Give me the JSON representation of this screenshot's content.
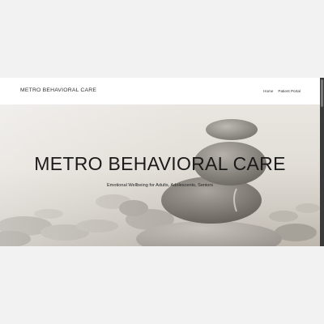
{
  "header": {
    "brand": "METRO BEHAVIORAL CARE",
    "nav": [
      "Home",
      "Patient Portal"
    ]
  },
  "hero": {
    "title": "METRO BEHAVIORAL CARE",
    "subtitle": "Emotional Wellbeing for Adults, Adolescents, Seniors",
    "image": "stacked-zen-stones-photo"
  },
  "colors": {
    "nav_background": "#ffffff",
    "text": "#333333",
    "page_background": "#f2f2f2",
    "scrollbar": "#3a3a3a"
  }
}
